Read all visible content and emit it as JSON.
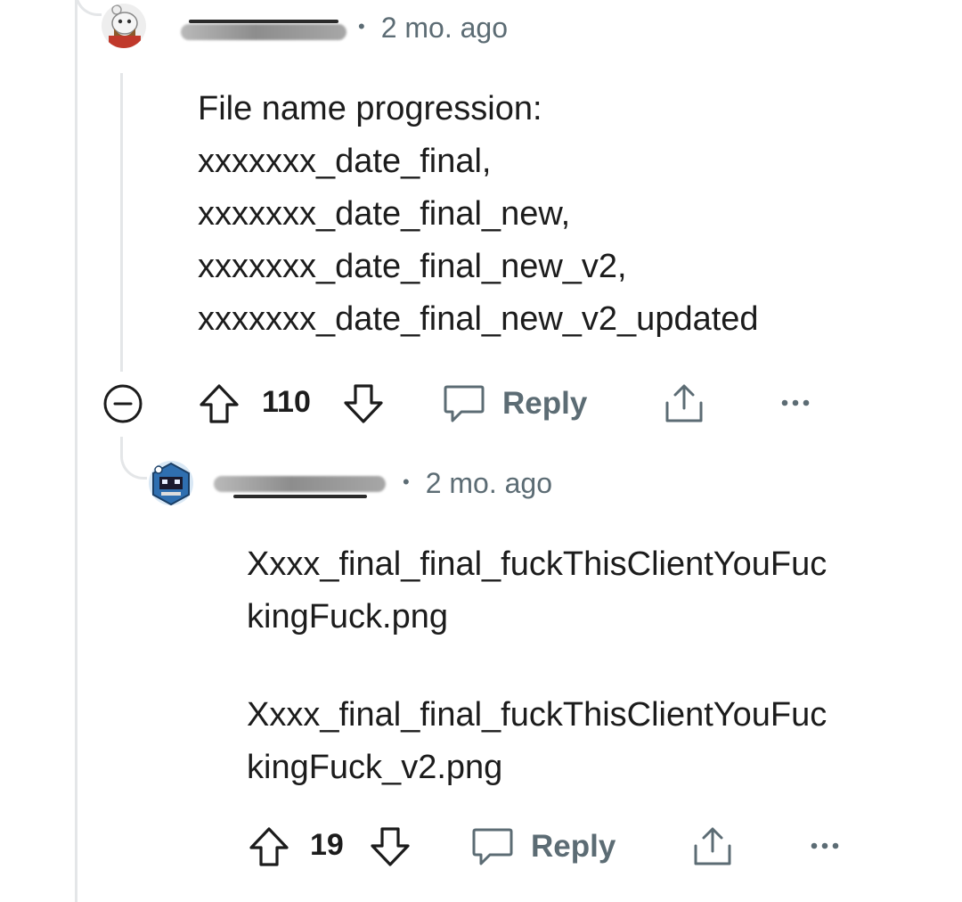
{
  "comments": [
    {
      "timestamp": "2 mo. ago",
      "body_lines": [
        "File name progression:",
        "xxxxxxx_date_final,",
        "xxxxxxx_date_final_new,",
        "xxxxxxx_date_final_new_v2,",
        "xxxxxxx_date_final_new_v2_updated"
      ],
      "score": "110",
      "reply_label": "Reply"
    },
    {
      "timestamp": "2 mo. ago",
      "body_lines": [
        "Xxxx_final_final_fuckThisClientYouFuc",
        "kingFuck.png",
        "",
        "Xxxx_final_final_fuckThisClientYouFuc",
        "kingFuck_v2.png"
      ],
      "score": "19",
      "reply_label": "Reply"
    }
  ],
  "icons": {
    "collapse": "minus-circle-icon",
    "upvote": "arrow-up-icon",
    "downvote": "arrow-down-icon",
    "reply": "speech-bubble-icon",
    "share": "share-icon",
    "more": "ellipsis-icon"
  },
  "colors": {
    "text": "#1c1c1c",
    "muted": "#5c6c74",
    "thread_line": "#e4e6e8"
  }
}
